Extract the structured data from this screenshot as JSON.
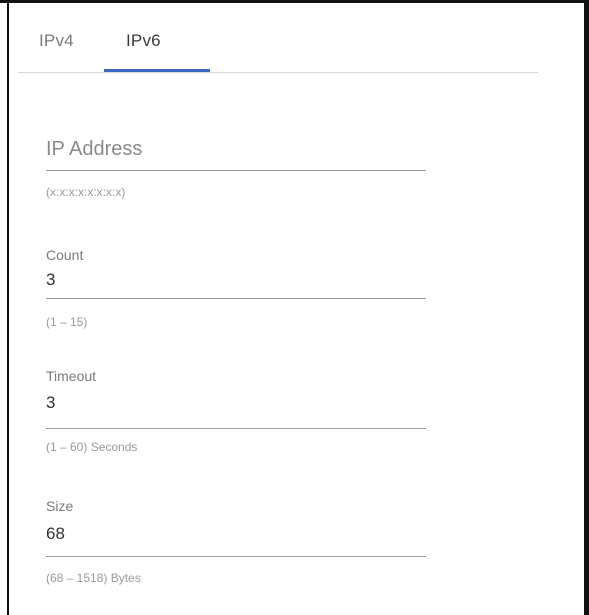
{
  "tabs": [
    {
      "label": "IPv4",
      "active": false
    },
    {
      "label": "IPv6",
      "active": true
    }
  ],
  "accent_color": "#3b66c4",
  "fields": {
    "ip_address": {
      "placeholder": "IP Address",
      "value": "",
      "hint": "(x:x:x:x:x:x:x:x)"
    },
    "count": {
      "label": "Count",
      "value": "3",
      "hint": "(1 – 15)"
    },
    "timeout": {
      "label": "Timeout",
      "value": "3",
      "hint": "(1 – 60) Seconds"
    },
    "size": {
      "label": "Size",
      "value": "68",
      "hint": "(68 – 1518) Bytes"
    }
  }
}
